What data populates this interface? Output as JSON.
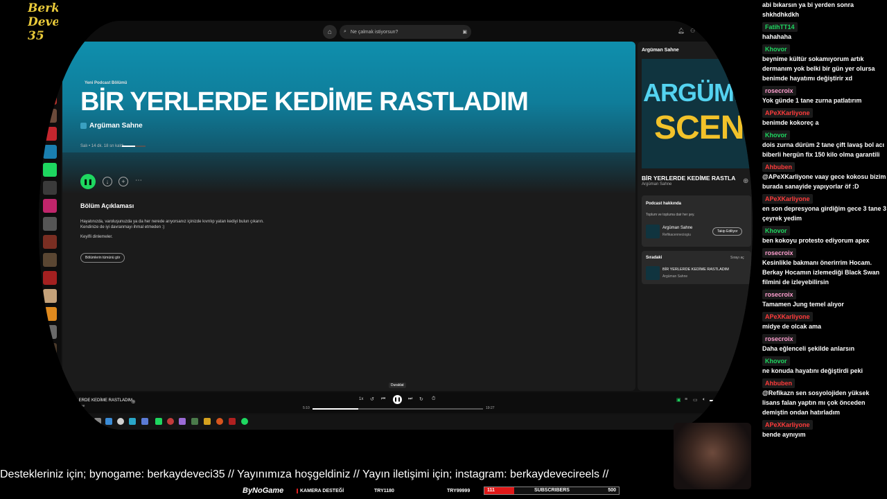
{
  "overlay": {
    "logo": "Berk\nDeve\n35"
  },
  "spotify": {
    "search_placeholder": "Ne çalmak istiyorsun?",
    "episode": {
      "kicker": "Yeni Podcast Bölümü",
      "title": "BİR YERLERDE KEDİME RASTLADIM",
      "podcast": "Argüman Sahne",
      "meta": "Salı • 14 dk. 18 sn kaldı",
      "progress": 0.55
    },
    "description": {
      "heading": "Bölüm Açıklaması",
      "text": "Hayatınızda, varoluşunuzda ya da her nerede arıyorsanız içinizde kıvrılıp yatan kediyi bulun çıkarın. Kendinize de iyi davranmayı ihmal etmeden :)",
      "thanks": "Keyifli dinlemeler.",
      "all_button": "Bölümlerin tümünü gör"
    },
    "right_panel": {
      "header": "Argüman Sahne",
      "cover_line1": "ARGÜME",
      "cover_line2": "SCEN",
      "now_title": "BİR YERLERDE KEDİME RASTLA",
      "now_podcast": "Argüman Sahne",
      "about": {
        "title": "Podcast hakkında",
        "desc": "Toplum ve topluma dair her şey.",
        "name": "Argüman Sahne",
        "host": "Refikacenneciogiu",
        "follow": "Takip Ediliyor"
      },
      "queue": {
        "title": "Sıradaki",
        "open": "Sırayı aç",
        "track": "BİR YERLERDE KEDİME RASTLADIM",
        "podcast": "Argüman Sahne"
      }
    },
    "player": {
      "track": "YERLERDE KEDİME RASTLADIM",
      "sub": "Sahne",
      "speed": "1x",
      "tooltip": "Duraklat",
      "elapsed": "5:10",
      "total": "19:27",
      "progress": 0.27
    }
  },
  "chat": [
    {
      "user": "",
      "text": "abi bıkarsın ya bi yerden sonra shkhdhkdkh"
    },
    {
      "user": "FatihTT14",
      "color": "#1ed760",
      "text": "hahahaha"
    },
    {
      "user": "Khovor",
      "color": "#1ed760",
      "text": "beynime kültür sokamıyorum artık dermanım yok belki bir gün yer olursa benimde hayatımı değiştirir xd"
    },
    {
      "user": "rosecroix",
      "color": "#ff9ecf",
      "text": "Yok günde 1 tane zurna patlatırım"
    },
    {
      "user": "APeXKarliyone",
      "color": "#ff3b3b",
      "text": "benimde kokoreç a"
    },
    {
      "user": "Khovor",
      "color": "#1ed760",
      "text": "dois zurna dürüm 2 tane çift lavaş bol acı biberli hergün fix 150 kilo olma garantili"
    },
    {
      "user": "Ahbuben",
      "color": "#ff3b3b",
      "text": "@APeXKarliyone vaay gece kokosu bizim burada sanayide yapıyorlar öf :D"
    },
    {
      "user": "APeXKarliyone",
      "color": "#ff3b3b",
      "text": "en son depresyona girdiğim gece 3 tane 3 çeyrek yedim"
    },
    {
      "user": "Khovor",
      "color": "#1ed760",
      "text": "ben kokoyu protesto ediyorum apex"
    },
    {
      "user": "rosecroix",
      "color": "#ff9ecf",
      "text": "Kesinlikle bakmanı önerirrim Hocam. Berkay Hocamın izlemediği Black Swan filmini de izleyebilirsin"
    },
    {
      "user": "rosecroix",
      "color": "#ff9ecf",
      "text": "Tamamen Jung temel alıyor"
    },
    {
      "user": "APeXKarliyone",
      "color": "#ff3b3b",
      "text": "midye de olcak ama"
    },
    {
      "user": "rosecroix",
      "color": "#ff9ecf",
      "text": "Daha eğlenceli şekilde anlarsın"
    },
    {
      "user": "Khovor",
      "color": "#1ed760",
      "text": "ne konuda hayatını değiştirdi peki"
    },
    {
      "user": "Ahbuben",
      "color": "#ff3b3b",
      "text": "@Refikazn sen sosyolojiden yüksek lisans falan yaptın mı çok önceden demiştin ondan hatırladım"
    },
    {
      "user": "APeXKarliyone",
      "color": "#ff3b3b",
      "text": "bende aynıyım"
    }
  ],
  "ticker": "Destekleriniz için; bynogame: berkaydeveci35 // Yayınımıza hoşgeldiniz // Yayın iletişimi için; instagram: berkaydevecireels //",
  "bottom": {
    "brand": "ByNoGame",
    "camera": "KAMERA DESTEĞİ",
    "try1": "TRY1180",
    "try2": "TRY99999",
    "sub_count": "111",
    "sub_label": "SUBSCRIBERS",
    "sub_goal": "500",
    "sub_progress": 0.222
  }
}
